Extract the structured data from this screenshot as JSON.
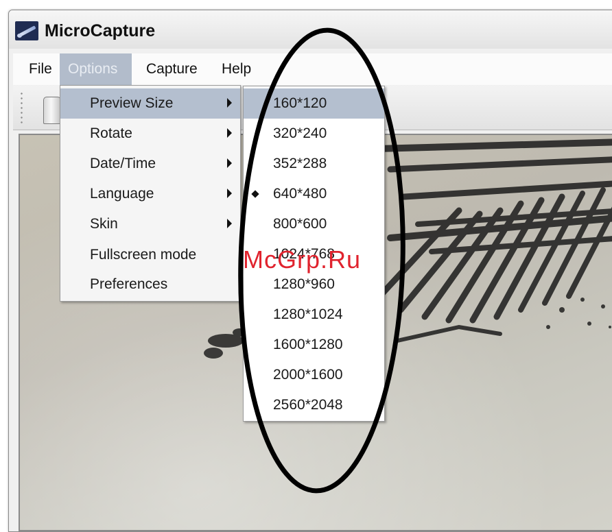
{
  "window": {
    "title": "MicroCapture"
  },
  "menubar": {
    "items": [
      {
        "label": "File"
      },
      {
        "label": "Options"
      },
      {
        "label": "Capture"
      },
      {
        "label": "Help"
      }
    ]
  },
  "options_menu": {
    "items": [
      {
        "label": "Preview Size"
      },
      {
        "label": "Rotate"
      },
      {
        "label": "Date/Time"
      },
      {
        "label": "Language"
      },
      {
        "label": "Skin"
      },
      {
        "label": "Fullscreen mode"
      },
      {
        "label": "Preferences"
      }
    ]
  },
  "preview_size_menu": {
    "selected": "640*480",
    "items": [
      {
        "label": "160*120"
      },
      {
        "label": "320*240"
      },
      {
        "label": "352*288"
      },
      {
        "label": "640*480"
      },
      {
        "label": "800*600"
      },
      {
        "label": "1024*768"
      },
      {
        "label": "1280*960"
      },
      {
        "label": "1280*1024"
      },
      {
        "label": "1600*1280"
      },
      {
        "label": "2000*1600"
      },
      {
        "label": "2560*2048"
      }
    ]
  },
  "watermark": {
    "text": "McGrp.Ru"
  },
  "colors": {
    "menu_highlight": "#b4bfcf",
    "annotation_ellipse": "#000000",
    "watermark": "#e0232e"
  },
  "icons": {
    "app": "microscope-icon",
    "toolbar": "camera-icon",
    "check": "bullet-icon"
  }
}
